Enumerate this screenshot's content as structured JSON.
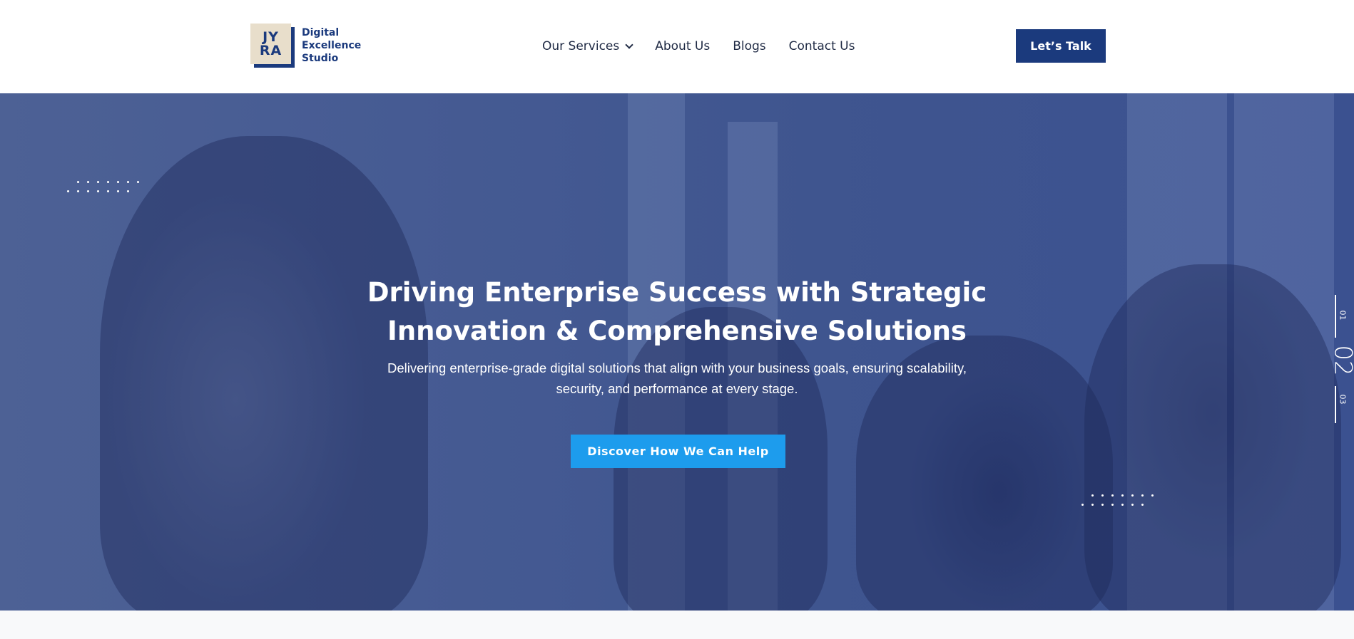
{
  "logo": {
    "mark_line1": "JY",
    "mark_line2": "RA",
    "text_line1": "Digital",
    "text_line2": "Excellence",
    "text_line3": "Studio"
  },
  "nav": {
    "items": [
      {
        "label": "Our Services",
        "has_dropdown": true
      },
      {
        "label": "About Us"
      },
      {
        "label": "Blogs"
      },
      {
        "label": "Contact Us"
      }
    ],
    "cta_label": "Let’s Talk"
  },
  "hero": {
    "title_line1": "Driving Enterprise Success with Strategic",
    "title_line2": "Innovation & Comprehensive Solutions",
    "subtitle_line1": "Delivering enterprise-grade digital solutions that align with your business goals, ensuring scalability,",
    "subtitle_line2": "security, and performance at every stage.",
    "cta_label": "Discover How We Can Help"
  },
  "slider": {
    "prev": "01",
    "current": "02",
    "next": "03"
  },
  "colors": {
    "brand_navy": "#1b3a7d",
    "accent_blue": "#1d9ced",
    "logo_beige": "#e8decb"
  }
}
